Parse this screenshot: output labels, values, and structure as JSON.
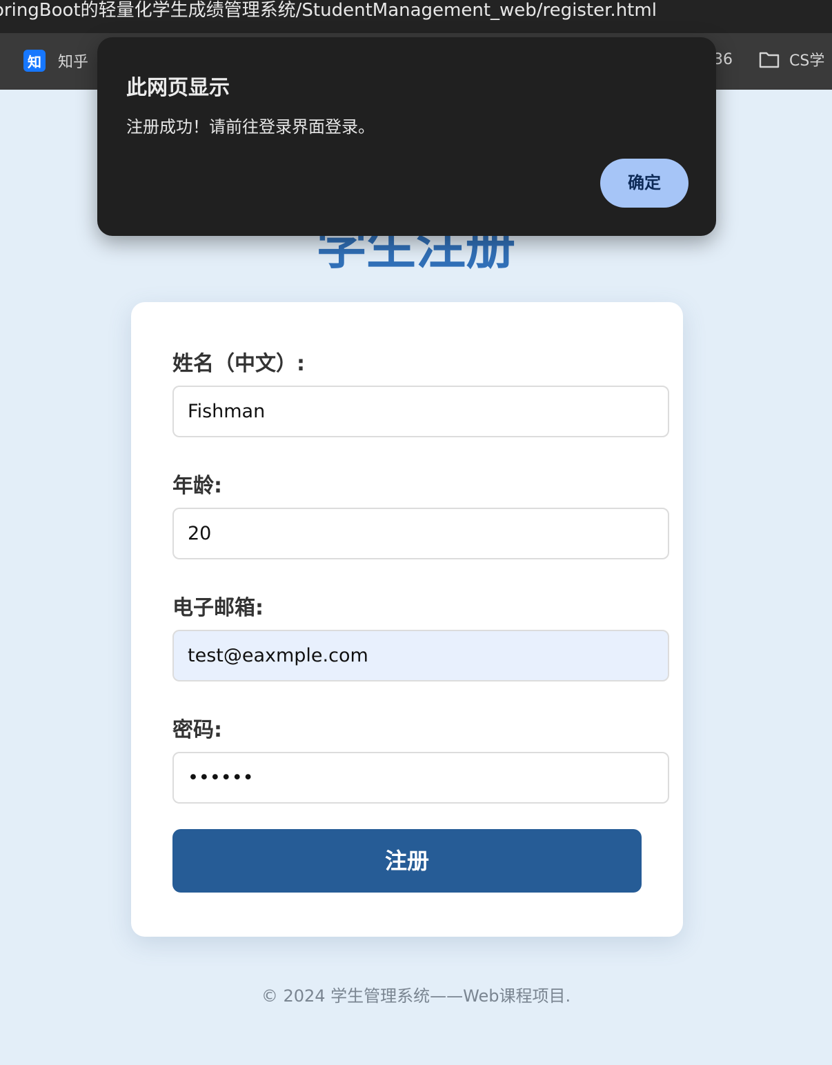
{
  "browser": {
    "url": "oringBoot的轻量化学生成绩管理系统/StudentManagement_web/register.html",
    "bookmarks": [
      {
        "label": "知乎",
        "icon": "zhihu-icon",
        "icon_text": "知"
      },
      {
        "label": "36"
      },
      {
        "label": "CS学",
        "icon": "folder-icon"
      }
    ]
  },
  "page": {
    "title": "学生注册",
    "form": {
      "name_label": "姓名（中文）:",
      "name_value": "Fishman",
      "age_label": "年龄:",
      "age_value": "20",
      "email_label": "电子邮箱:",
      "email_value": "test@eaxmple.com",
      "password_label": "密码:",
      "password_value": "••••••",
      "submit_label": "注册"
    },
    "footer": "© 2024 学生管理系统——Web课程项目."
  },
  "dialog": {
    "title": "此网页显示",
    "message": "注册成功！请前往登录界面登录。",
    "ok_label": "确定"
  },
  "colors": {
    "page_bg": "#e3eef8",
    "title": "#3170b8",
    "submit_bg": "#265c96",
    "dialog_bg": "#202020",
    "dialog_btn": "#a6c5f7"
  }
}
